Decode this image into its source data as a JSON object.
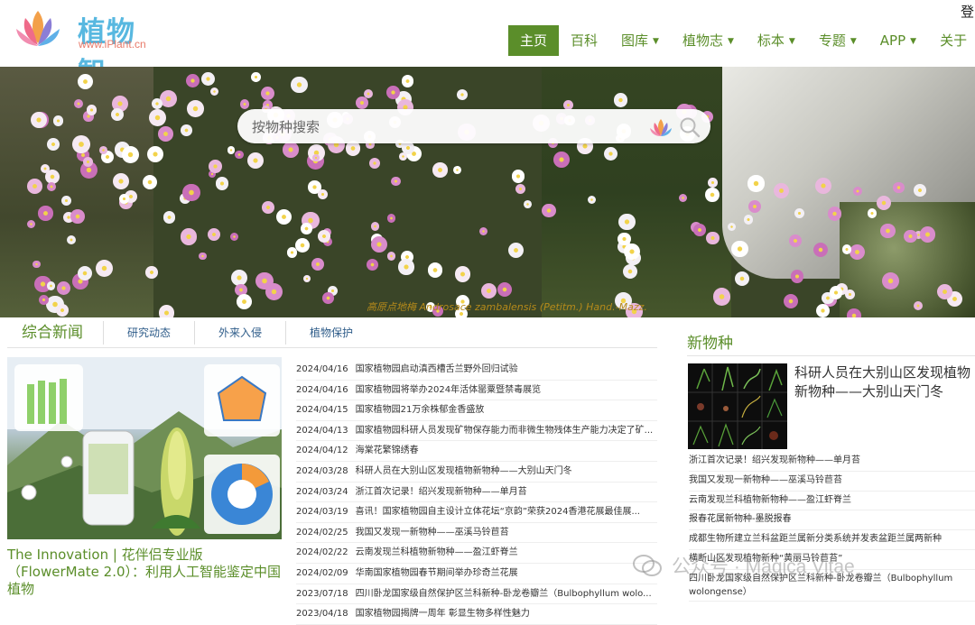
{
  "header": {
    "logo_text": "植物智",
    "logo_sub": "www.iPlant.cn",
    "login": "登",
    "nav": [
      {
        "label": "主页",
        "dropdown": false,
        "active": true
      },
      {
        "label": "百科",
        "dropdown": false
      },
      {
        "label": "图库",
        "dropdown": true
      },
      {
        "label": "植物志",
        "dropdown": true
      },
      {
        "label": "标本",
        "dropdown": true
      },
      {
        "label": "专题",
        "dropdown": true
      },
      {
        "label": "APP",
        "dropdown": true
      },
      {
        "label": "关于",
        "dropdown": false
      }
    ]
  },
  "hero": {
    "search_placeholder": "按物种搜索",
    "caption": "高原点地梅 Androsace zambalensis (Petitm.) Hand.-Mazz."
  },
  "news": {
    "tabs": [
      "综合新闻",
      "研究动态",
      "外来入侵",
      "植物保护"
    ],
    "feature_title": "The Innovation | 花伴侣专业版（FlowerMate 2.0）：利用人工智能鉴定中国植物",
    "items": [
      {
        "date": "2024/04/16",
        "title": "国家植物园启动滇西槽舌兰野外回归试验"
      },
      {
        "date": "2024/04/16",
        "title": "国家植物园将举办2024年活体罂粟暨禁毒展览"
      },
      {
        "date": "2024/04/15",
        "title": "国家植物园21万余株郁金香盛放"
      },
      {
        "date": "2024/04/13",
        "title": "国家植物园科研人员发现矿物保存能力而非微生物残体生产能力决定了矿..."
      },
      {
        "date": "2024/04/12",
        "title": "海棠花繁锦绣春"
      },
      {
        "date": "2024/03/28",
        "title": "科研人员在大别山区发现植物新物种——大别山天门冬"
      },
      {
        "date": "2024/03/24",
        "title": "浙江首次记录！绍兴发现新物种——单月苔"
      },
      {
        "date": "2024/03/19",
        "title": "喜讯！国家植物园自主设计立体花坛“京韵”荣获2024香港花展最佳展..."
      },
      {
        "date": "2024/02/25",
        "title": "我国又发现一新物种——巫溪马铃苣苔"
      },
      {
        "date": "2024/02/22",
        "title": "云南发现兰科植物新物种——盈江虾脊兰"
      },
      {
        "date": "2024/02/09",
        "title": "华南国家植物园春节期间举办珍奇兰花展"
      },
      {
        "date": "2023/07/18",
        "title": "四川卧龙国家级自然保护区兰科新种-卧龙卷瓣兰（Bulbophyllum wolo..."
      },
      {
        "date": "2023/04/18",
        "title": "国家植物园揭牌一周年 彰显生物多样性魅力"
      }
    ]
  },
  "new_species": {
    "title": "新物种",
    "feature": "科研人员在大别山区发现植物新物种——大别山天门冬",
    "items": [
      "浙江首次记录！绍兴发现新物种——单月苔",
      "我国又发现一新物种——巫溪马铃苣苔",
      "云南发现兰科植物新物种——盈江虾脊兰",
      "报春花属新物种-墨脱报春",
      "成都生物所建立兰科盆距兰属新分类系统并发表盆距兰属两新种",
      "横断山区发现植物新种“黄丽马铃苣苔”",
      "四川卧龙国家级自然保护区兰科新种-卧龙卷瓣兰（Bulbophyllum wolongense）"
    ]
  },
  "watermark": "公众号 · Magica Vitae",
  "colors": {
    "accent": "#5b8e2a",
    "link": "#2f5d8a",
    "caption": "#b58a1a"
  }
}
